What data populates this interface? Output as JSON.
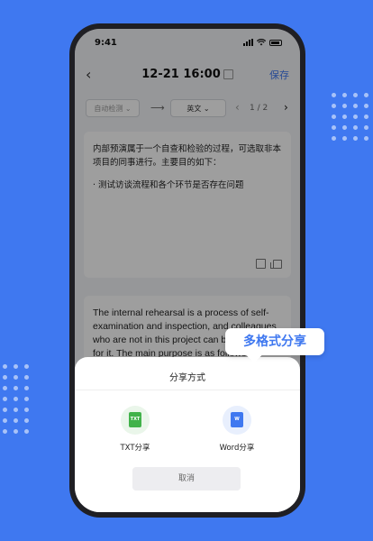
{
  "status_bar": {
    "time": "9:41"
  },
  "nav": {
    "title": "12-21 16:00",
    "save_label": "保存"
  },
  "toolbar": {
    "source_lang": "自动检测",
    "target_lang": "英文",
    "page_current": "1",
    "page_total": "2"
  },
  "source_card": {
    "text": "内部预演属于一个自查和检验的过程，可选取非本项目的同事进行。主要目的如下：",
    "bullet": "· 测试访谈流程和各个环节是否存在问题"
  },
  "target_card": {
    "text": "The internal rehearsal is a process of self-examination and inspection, and colleagues who are not in this project can be selected for it. The main purpose is as follows:"
  },
  "share_sheet": {
    "title": "分享方式",
    "options": [
      {
        "label": "TXT分享",
        "icon": "txt-file-icon",
        "icon_text": "TXT"
      },
      {
        "label": "Word分享",
        "icon": "word-file-icon",
        "icon_text": "W"
      }
    ],
    "cancel_label": "取消"
  },
  "callout": {
    "text": "多格式分享"
  },
  "colors": {
    "accent": "#3f78f0",
    "background": "#3f78f0",
    "txt_green": "#41b24a"
  }
}
